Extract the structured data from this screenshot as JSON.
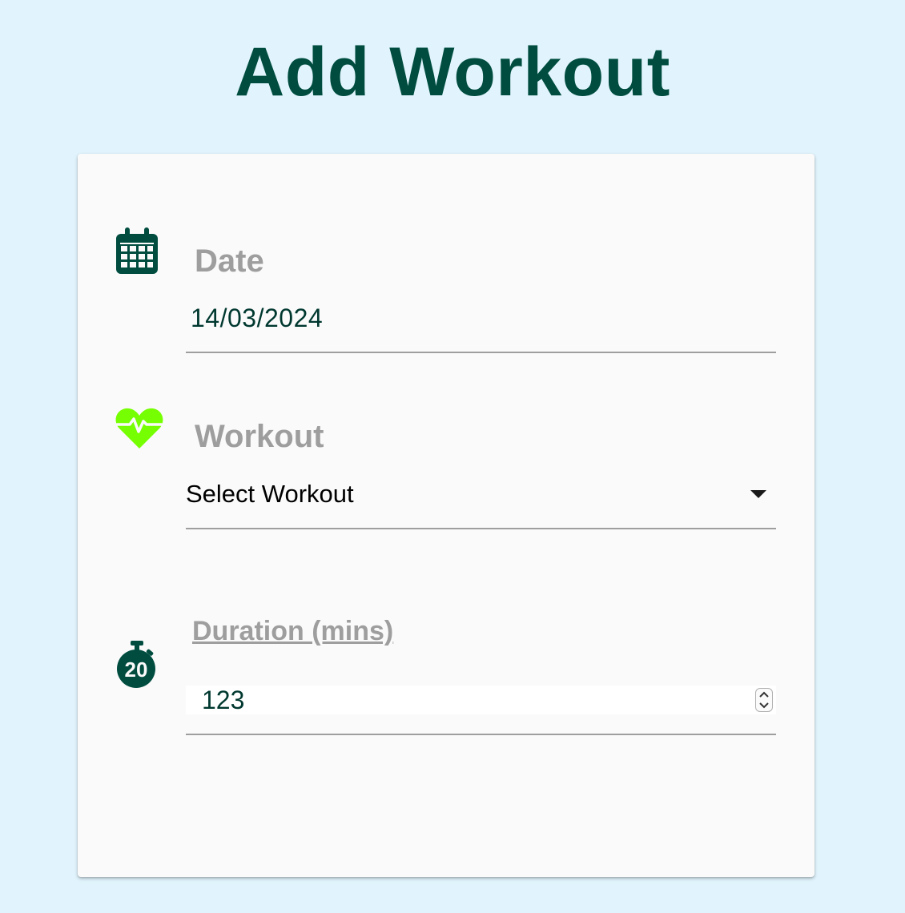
{
  "page": {
    "title": "Add Workout"
  },
  "form": {
    "date": {
      "icon": "calendar-icon",
      "label": "Date",
      "value": "14/03/2024"
    },
    "workout": {
      "icon": "heart-pulse-icon",
      "label": "Workout",
      "selected": "Select Workout"
    },
    "duration": {
      "icon": "stopwatch-20-icon",
      "label": "Duration (mins)",
      "value": "123",
      "icon_text": "20"
    }
  },
  "colors": {
    "background": "#e1f4fd",
    "primary": "#004d40",
    "accent": "#76ff03",
    "label": "#9e9e9e"
  }
}
